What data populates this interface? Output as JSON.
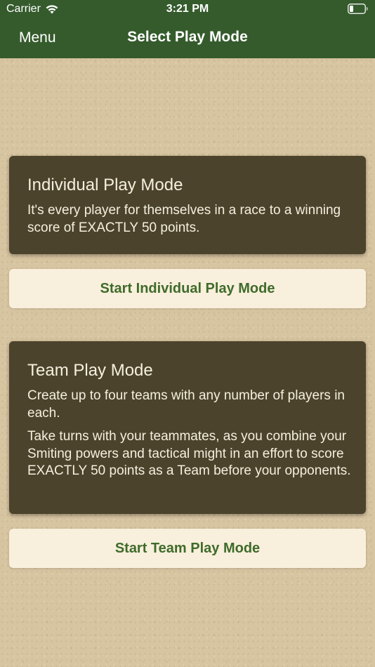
{
  "status_bar": {
    "carrier": "Carrier",
    "time": "3:21 PM",
    "wifi_icon": "wifi-icon",
    "battery_icon": "battery-low-icon"
  },
  "nav": {
    "menu_label": "Menu",
    "title": "Select Play Mode"
  },
  "individual": {
    "title": "Individual Play Mode",
    "description": "It's every player for themselves in a race to a winning score of EXACTLY 50 points.",
    "button_label": "Start Individual Play Mode"
  },
  "team": {
    "title": "Team Play Mode",
    "description_1": "Create up to four teams with any number of players in each.",
    "description_2": "Take turns with your teammates, as you combine your Smiting powers and tactical might in an effort to score EXACTLY 50 points as a Team before your opponents.",
    "button_label": "Start Team Play Mode"
  },
  "colors": {
    "header": "#355b2c",
    "card": "#4b432b",
    "button_bg": "#f8efdc",
    "button_text": "#3f6b2a",
    "background": "#d7c4a0"
  }
}
